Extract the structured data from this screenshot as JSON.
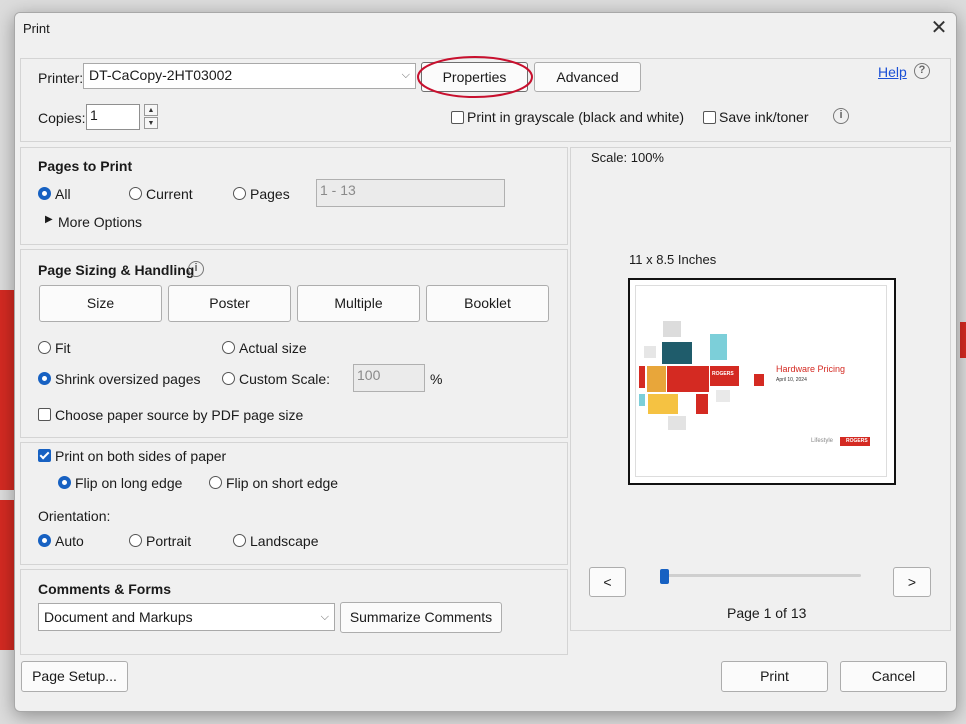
{
  "window": {
    "title": "Print"
  },
  "printer": {
    "label": "Printer:",
    "value": "DT-CaCopy-2HT03002",
    "properties": "Properties",
    "advanced": "Advanced",
    "help": "Help"
  },
  "copies": {
    "label": "Copies:",
    "value": "1"
  },
  "options": {
    "grayscale": "Print in grayscale (black and white)",
    "save_ink": "Save ink/toner"
  },
  "pages_to_print": {
    "title": "Pages to Print",
    "all": "All",
    "current": "Current",
    "pages": "Pages",
    "pages_range": "1 - 13",
    "more_options": "More Options"
  },
  "sizing": {
    "title": "Page Sizing & Handling",
    "tabs": [
      "Size",
      "Poster",
      "Multiple",
      "Booklet"
    ],
    "fit": "Fit",
    "actual_size": "Actual size",
    "shrink": "Shrink oversized pages",
    "custom_scale": "Custom Scale:",
    "custom_value": "100",
    "percent": "%",
    "paper_source": "Choose paper source by PDF page size"
  },
  "duplex": {
    "both_sides": "Print on both sides of paper",
    "long_edge": "Flip on long edge",
    "short_edge": "Flip on short edge",
    "orientation_label": "Orientation:",
    "auto": "Auto",
    "portrait": "Portrait",
    "landscape": "Landscape"
  },
  "comments": {
    "title": "Comments & Forms",
    "value": "Document and Markups",
    "summarize": "Summarize Comments"
  },
  "preview": {
    "scale": "Scale: 100%",
    "paper": "11 x 8.5 Inches",
    "doc_title": "Hardware Pricing",
    "doc_date": "April 10, 2024",
    "brand": "ROGERS",
    "footer_brand": "Lifestyle",
    "prev": "<",
    "next": ">",
    "page_status": "Page 1 of 13",
    "slider_position": 0.0
  },
  "footer": {
    "page_setup": "Page Setup...",
    "print": "Print",
    "cancel": "Cancel"
  },
  "colors": {
    "accent": "#1761c2",
    "brand_red": "#d42a22",
    "highlight": "#c8102e"
  }
}
